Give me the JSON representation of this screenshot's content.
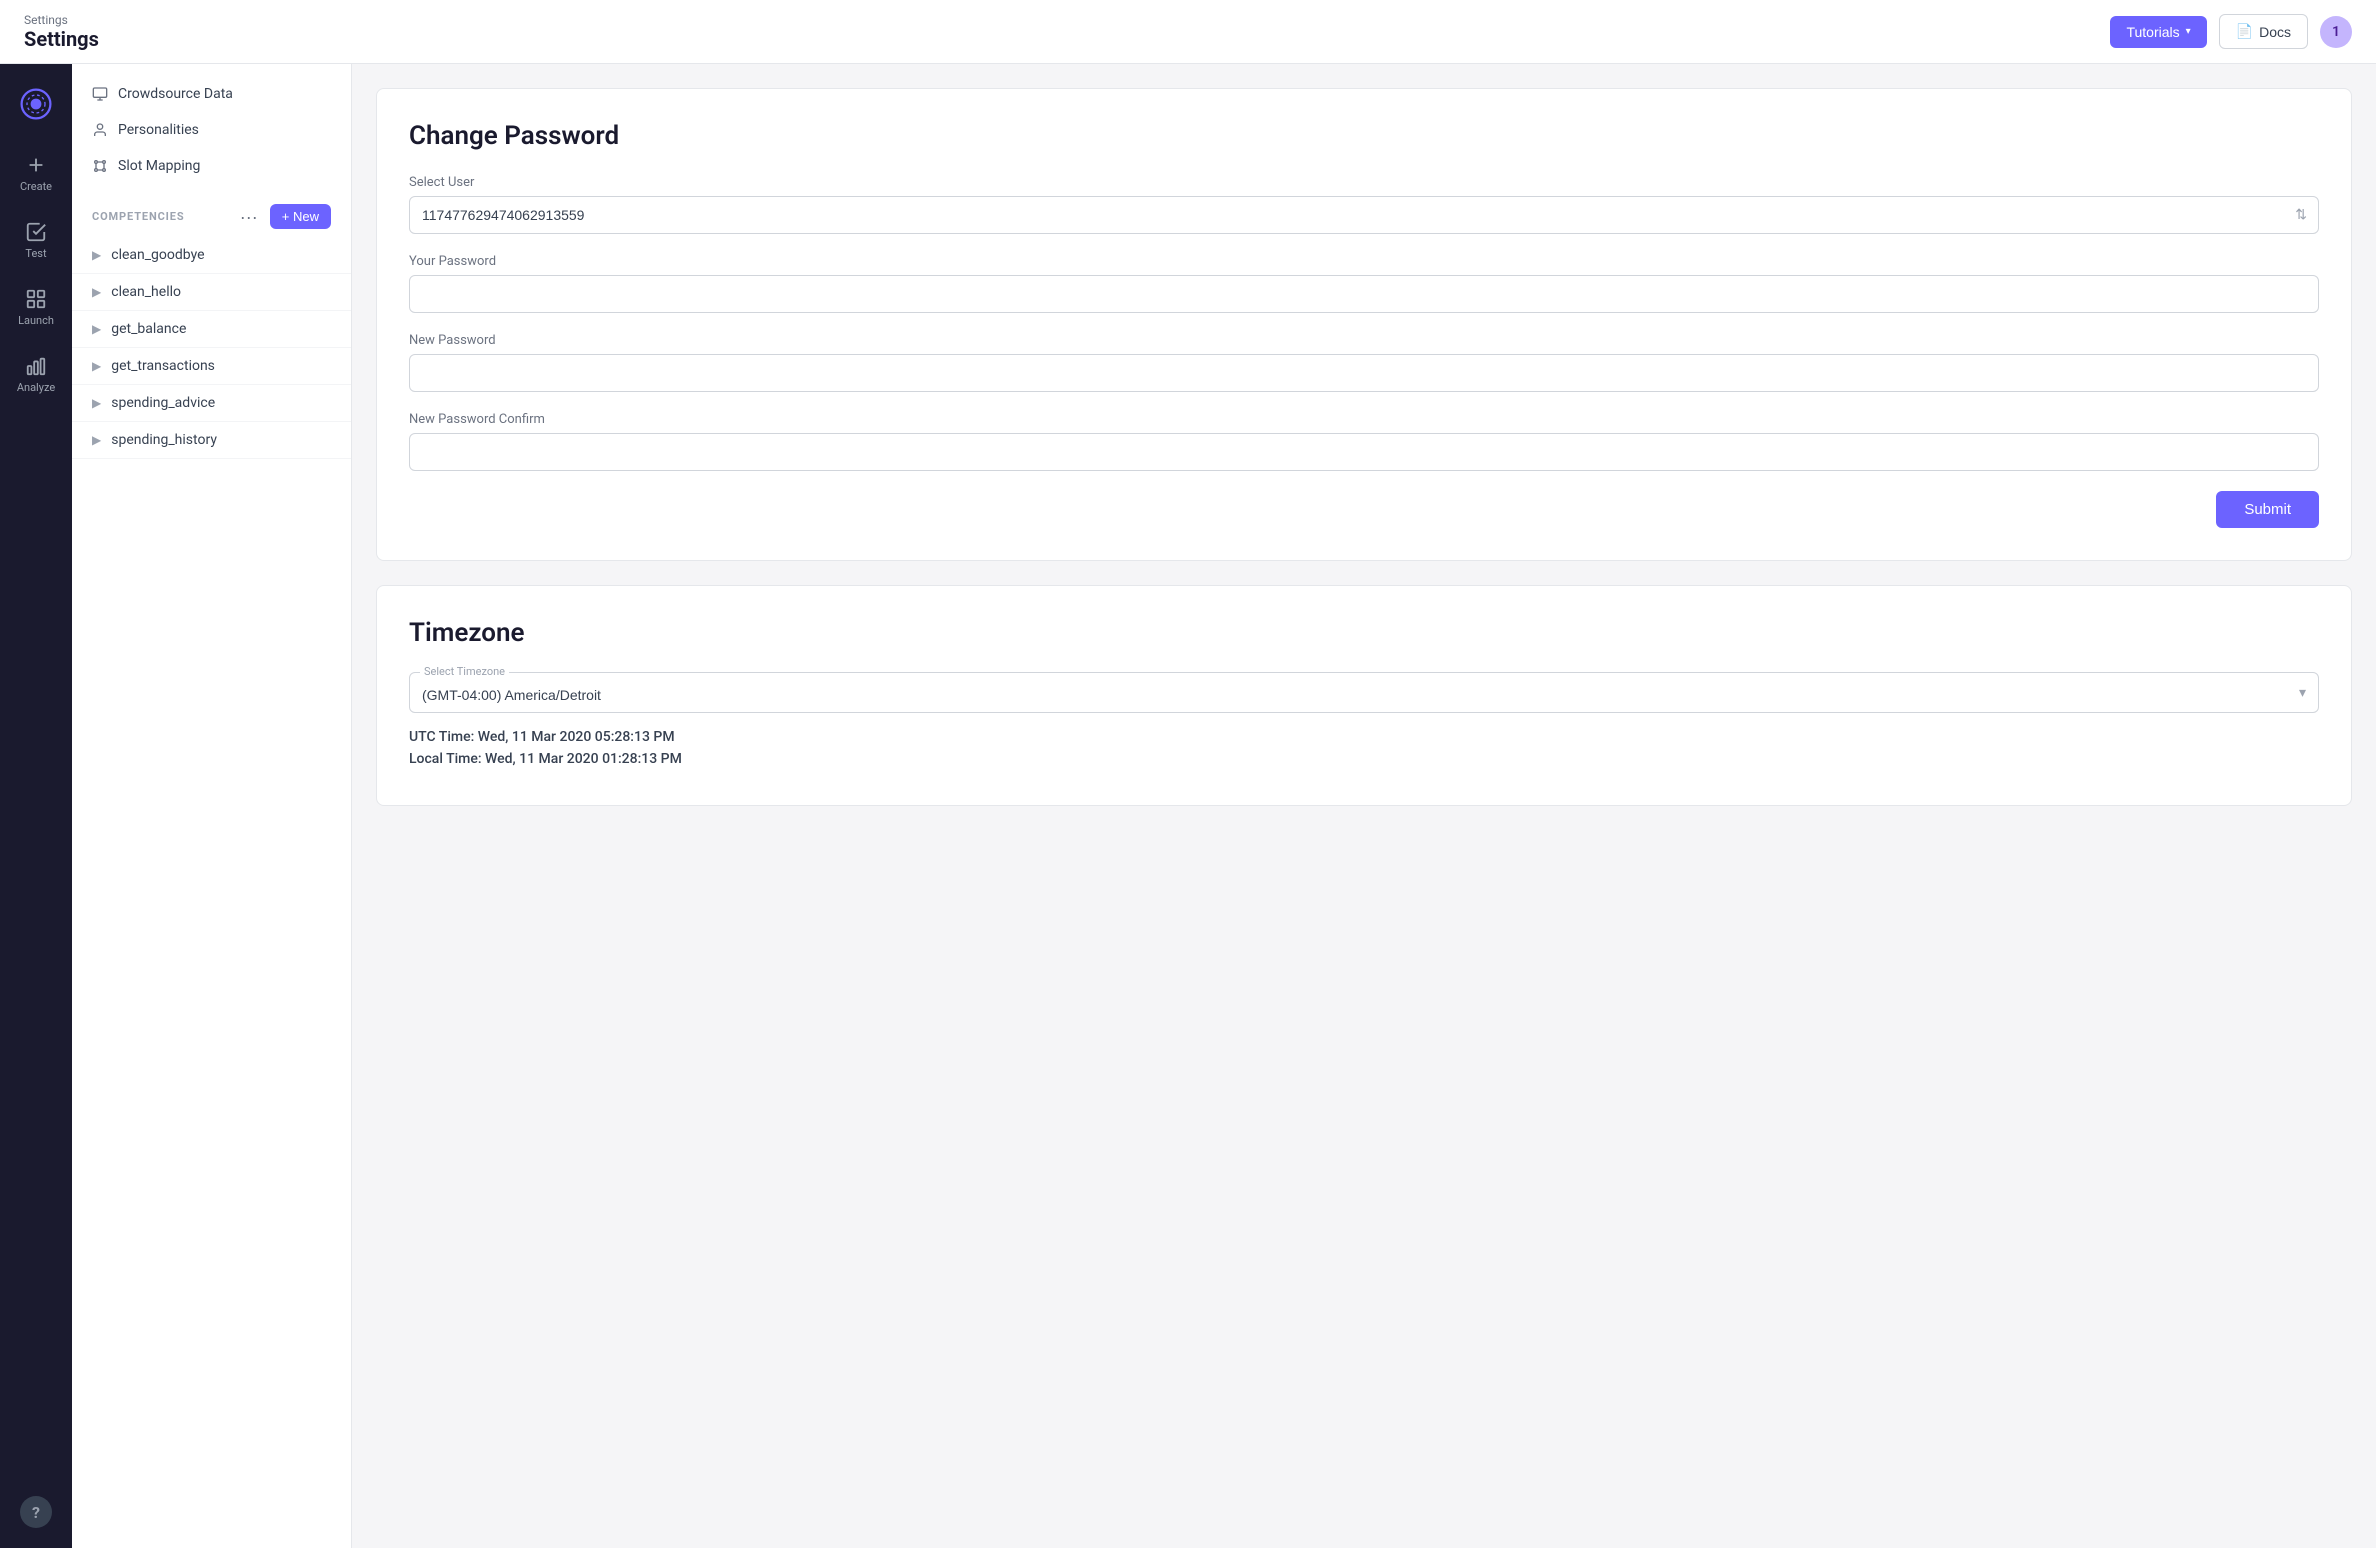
{
  "header": {
    "breadcrumb": "Settings",
    "title": "Settings",
    "tutorials_label": "Tutorials",
    "docs_label": "Docs",
    "user_avatar": "1"
  },
  "left_nav": {
    "items": [
      {
        "id": "create",
        "label": "Create"
      },
      {
        "id": "test",
        "label": "Test"
      },
      {
        "id": "launch",
        "label": "Launch"
      },
      {
        "id": "analyze",
        "label": "Analyze"
      }
    ],
    "help_label": "?"
  },
  "sidebar": {
    "top_items": [
      {
        "id": "crowdsource-data",
        "label": "Crowdsource Data"
      },
      {
        "id": "personalities",
        "label": "Personalities"
      },
      {
        "id": "slot-mapping",
        "label": "Slot Mapping"
      }
    ],
    "competencies_label": "COMPETENCIES",
    "new_button_label": "+ New",
    "competencies": [
      {
        "id": "clean_goodbye",
        "label": "clean_goodbye"
      },
      {
        "id": "clean_hello",
        "label": "clean_hello"
      },
      {
        "id": "get_balance",
        "label": "get_balance"
      },
      {
        "id": "get_transactions",
        "label": "get_transactions"
      },
      {
        "id": "spending_advice",
        "label": "spending_advice"
      },
      {
        "id": "spending_history",
        "label": "spending_history"
      }
    ]
  },
  "change_password": {
    "title": "Change Password",
    "select_user_label": "Select User",
    "select_user_value": "117477629474062913559",
    "your_password_label": "Your Password",
    "new_password_label": "New Password",
    "new_password_confirm_label": "New Password Confirm",
    "submit_label": "Submit"
  },
  "timezone": {
    "title": "Timezone",
    "select_timezone_label": "Select Timezone",
    "selected_timezone": "(GMT-04:00) America/Detroit",
    "utc_time_label": "UTC Time: Wed, 11 Mar 2020 05:28:13 PM",
    "local_time_label": "Local Time: Wed, 11 Mar 2020 01:28:13 PM"
  }
}
